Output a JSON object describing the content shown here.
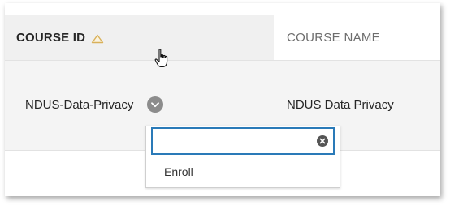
{
  "table": {
    "columns": {
      "course_id": "COURSE ID",
      "course_name": "COURSE NAME"
    },
    "sort_icon": "triangle-up-outline-icon",
    "rows": [
      {
        "course_id": "NDUS-Data-Privacy",
        "course_name": "NDUS Data Privacy"
      }
    ]
  },
  "context_menu": {
    "search_value": "",
    "items": [
      {
        "label": "Enroll"
      }
    ]
  },
  "colors": {
    "header_bg": "#f0f0f0",
    "row_bg": "#f4f4f4",
    "sort_icon": "#d9b15a",
    "focus_border": "#2a7ab8"
  }
}
